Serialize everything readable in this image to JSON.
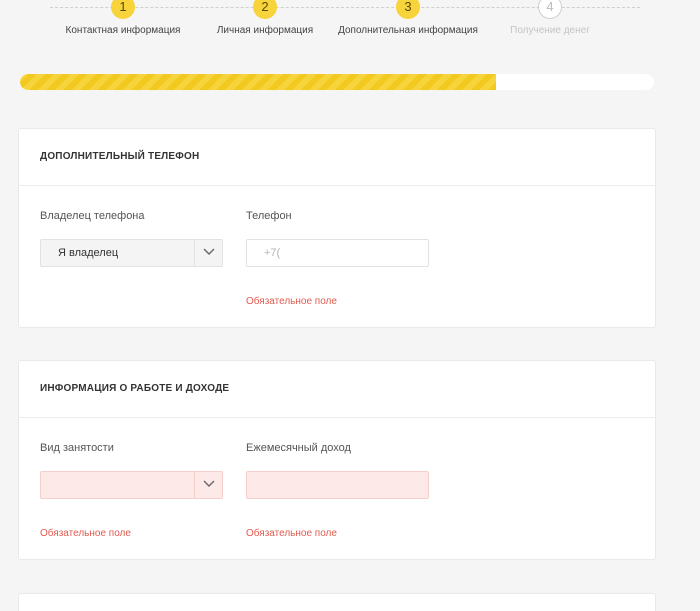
{
  "stepper": {
    "steps": [
      {
        "number": "1",
        "label": "Контактная информация"
      },
      {
        "number": "2",
        "label": "Личная информация"
      },
      {
        "number": "3",
        "label": "Дополнительная информация"
      },
      {
        "number": "4",
        "label": "Получение денег"
      }
    ]
  },
  "progress": {
    "percent": 75
  },
  "phone_section": {
    "title": "ДОПОЛНИТЕЛЬНЫЙ ТЕЛЕФОН",
    "owner_label": "Владелец телефона",
    "owner_value": "Я владелец",
    "phone_label": "Телефон",
    "phone_placeholder": "+7(",
    "phone_error": "Обязательное поле"
  },
  "work_section": {
    "title": "ИНФОРМАЦИЯ О РАБОТЕ И ДОХОДЕ",
    "employment_label": "Вид занятости",
    "employment_value": "",
    "employment_error": "Обязательное поле",
    "income_label": "Ежемесячный доход",
    "income_value": "",
    "income_error": "Обязательное поле"
  },
  "colors": {
    "accent": "#f7d33c",
    "error": "#e25a4e",
    "error_bg": "#fde9e8"
  },
  "icons": {
    "select_arrow": "chevron-down-icon"
  }
}
